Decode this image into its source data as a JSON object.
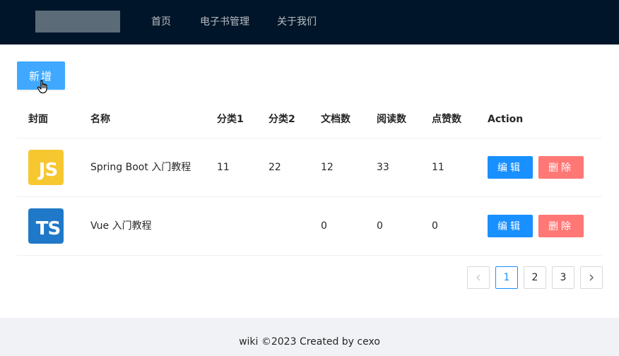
{
  "header": {
    "nav": [
      "首页",
      "电子书管理",
      "关于我们"
    ]
  },
  "toolbar": {
    "add_label": "新增"
  },
  "table": {
    "columns": [
      "封面",
      "名称",
      "分类1",
      "分类2",
      "文档数",
      "阅读数",
      "点赞数",
      "Action"
    ],
    "rows": [
      {
        "cover_text": "JS",
        "name": "Spring Boot 入门教程",
        "category1": "11",
        "category2": "22",
        "doc_count": "12",
        "view_count": "33",
        "vote_count": "11",
        "edit_label": "编辑",
        "delete_label": "删除"
      },
      {
        "cover_text": "TS",
        "name": "Vue 入门教程",
        "category1": "",
        "category2": "",
        "doc_count": "0",
        "view_count": "0",
        "vote_count": "0",
        "edit_label": "编辑",
        "delete_label": "删除"
      }
    ]
  },
  "pagination": {
    "pages": [
      "1",
      "2",
      "3"
    ],
    "current": "1"
  },
  "footer": {
    "text": "wiki ©2023 Created by cexo"
  },
  "colors": {
    "header_bg": "#001529",
    "primary": "#1890ff",
    "danger": "#ff7875",
    "js_cover": "#f7c730",
    "ts_cover": "#1f78c8"
  }
}
